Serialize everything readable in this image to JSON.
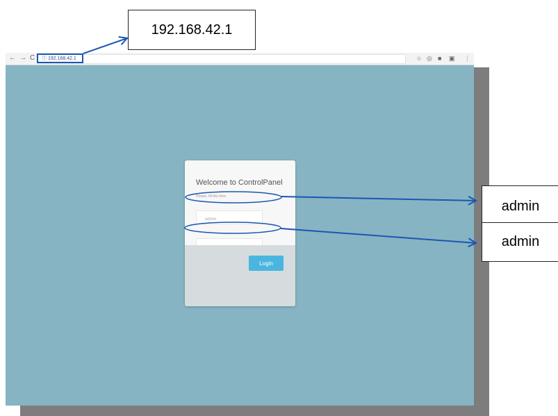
{
  "browser": {
    "nav": {
      "back": "←",
      "forward": "→",
      "reload": "C"
    },
    "url_info_icon": "ⓘ",
    "url": "192.168.42.1",
    "toolbar_icons": [
      "☆",
      "◎",
      "■",
      "▣",
      "⋮"
    ],
    "background_color": "#86b4c3"
  },
  "login": {
    "title": "Welcome to ControlPanel",
    "subtitle": "Please, fill this form",
    "username_value": "admin",
    "password_value": "•••••",
    "button_label": "Login"
  },
  "annotations": {
    "url_label": "192.168.42.1",
    "username_label": "admin",
    "password_label": "admin",
    "color": "#1a56b3"
  }
}
